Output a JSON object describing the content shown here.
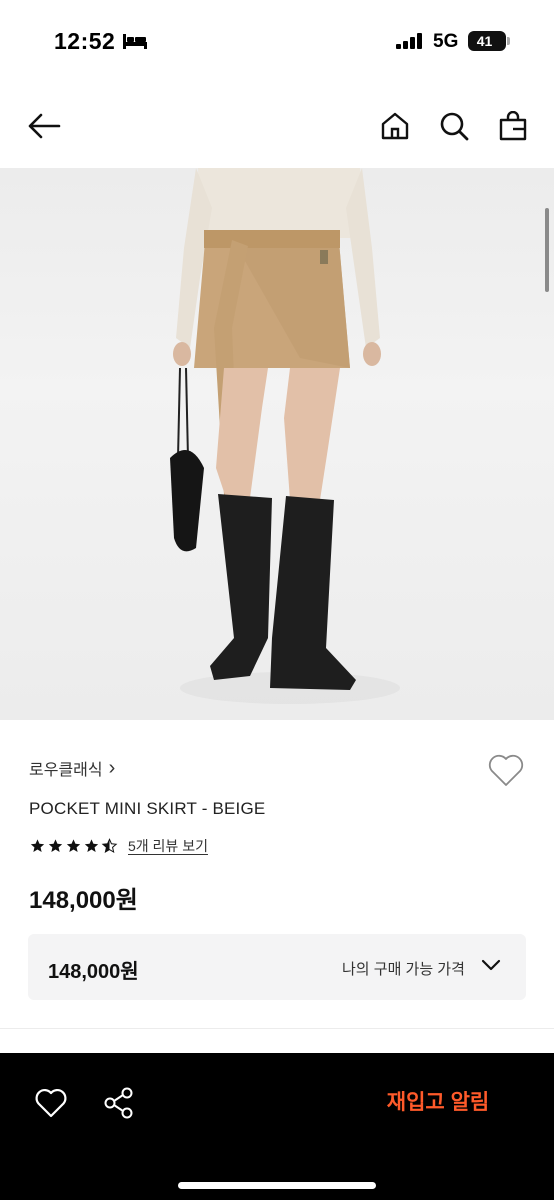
{
  "status_bar": {
    "time": "12:52",
    "network": "5G",
    "battery": "41"
  },
  "nav": {
    "back_icon": "arrow-left-icon",
    "home_icon": "home-icon",
    "search_icon": "search-icon",
    "bag_icon": "shopping-bag-icon"
  },
  "product": {
    "brand": "로우클래식",
    "brand_chevron": "›",
    "name": "POCKET MINI SKIRT - BEIGE",
    "rating": 4.5,
    "review_link": "5개 리뷰 보기",
    "price": "148,000원"
  },
  "price_box": {
    "price": "148,000원",
    "label": "나의 구매 가능 가격"
  },
  "bottom_bar": {
    "restock_label": "재입고 알림"
  },
  "colors": {
    "accent": "#ff5a2a",
    "bottom_bar_bg": "#000000",
    "price_box_bg": "#f4f4f5"
  }
}
